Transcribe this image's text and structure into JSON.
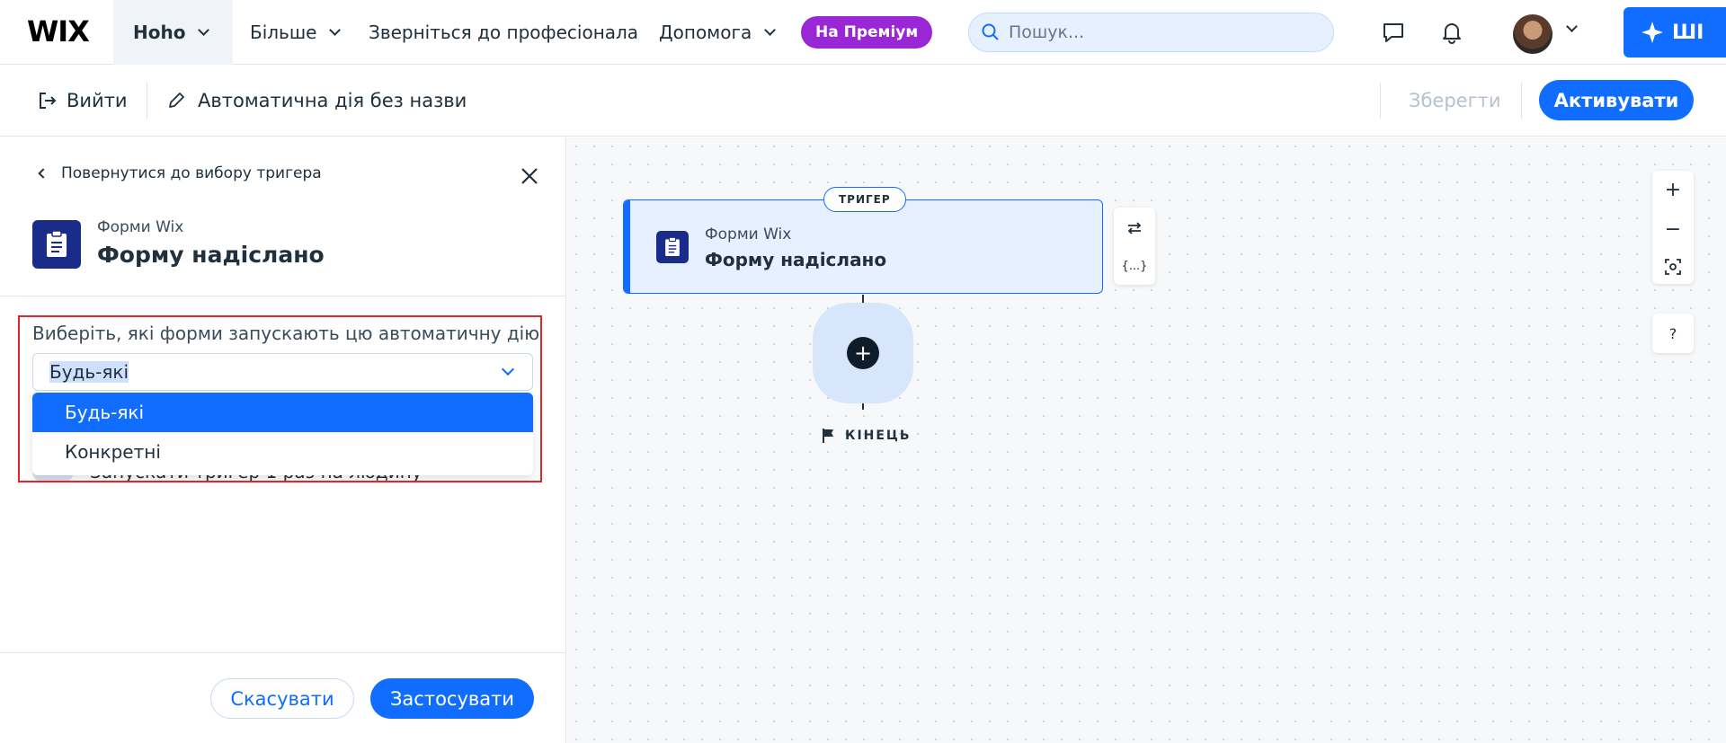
{
  "topbar": {
    "logo": "WIX",
    "site_name": "Hoho",
    "nav": [
      "Більше",
      "Зверніться до професіонала",
      "Допомога"
    ],
    "premium_label": "На Преміум",
    "search_placeholder": "Пошук...",
    "ai_label": "ШІ"
  },
  "toolbar": {
    "exit_label": "Вийти",
    "automation_title": "Автоматична дія без назви",
    "save_label": "Зберегти",
    "activate_label": "Активувати"
  },
  "panel": {
    "back_label": "Повернутися до вибору тригера",
    "app_subtitle": "Форми Wix",
    "app_title": "Форму надіслано",
    "select_label": "Виберіть, які форми запускають цю автоматичну дію",
    "selected_value": "Будь-які",
    "options": [
      "Будь-які",
      "Конкретні"
    ],
    "hidden_toggle_label": "Запускати тригер 1 раз на людину",
    "cancel_label": "Скасувати",
    "apply_label": "Застосувати"
  },
  "canvas": {
    "trigger_badge": "ТРИГЕР",
    "node_subtitle": "Форми Wix",
    "node_title": "Форму надіслано",
    "variables_label": "{...}",
    "end_label": "КІНЕЦЬ",
    "help_label": "?"
  },
  "colors": {
    "accent": "#116dff",
    "premium": "#9a27d5",
    "highlight": "#e0262b",
    "app_icon": "#1a2c8a"
  }
}
